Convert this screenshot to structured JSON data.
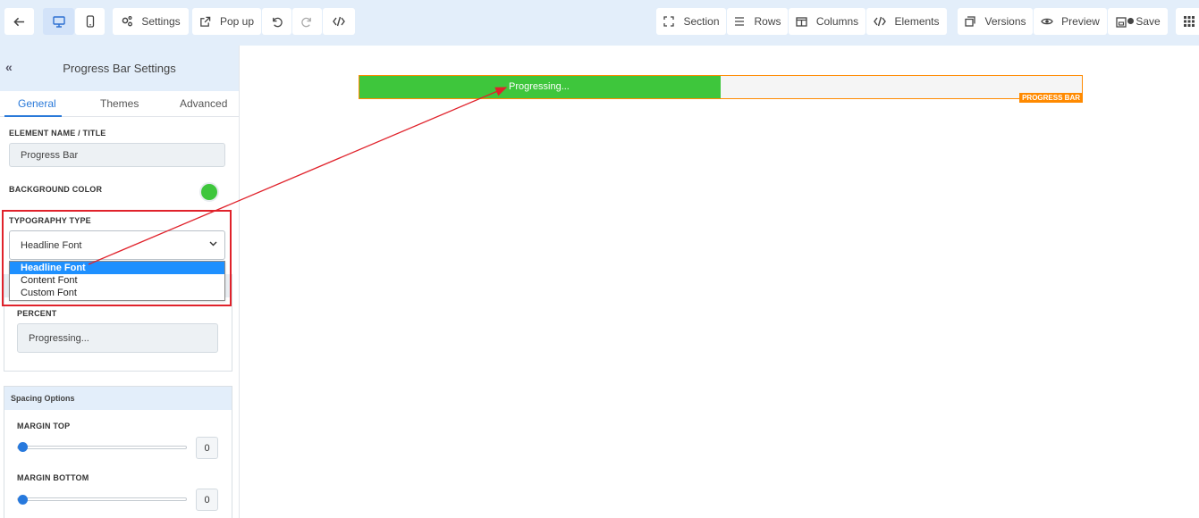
{
  "toolbar": {
    "back_icon": "arrow-left-icon",
    "desktop_icon": "desktop-icon",
    "mobile_icon": "mobile-icon",
    "settings_label": "Settings",
    "popup_label": "Pop up",
    "section_label": "Section",
    "rows_label": "Rows",
    "columns_label": "Columns",
    "elements_label": "Elements",
    "versions_label": "Versions",
    "preview_label": "Preview",
    "save_label": "Save"
  },
  "sidebar": {
    "title": "Progress Bar Settings",
    "collapse_glyph": "«",
    "tabs": [
      {
        "label": "General"
      },
      {
        "label": "Themes"
      },
      {
        "label": "Advanced"
      }
    ],
    "element_name_label": "ELEMENT NAME / TITLE",
    "element_name_value": "Progress Bar",
    "background_color_label": "BACKGROUND COLOR",
    "background_color": "#3ec63c",
    "typography_label": "TYPOGRAPHY TYPE",
    "typography_selected": "Headline Font",
    "typography_options": [
      "Headline Font",
      "Content Font",
      "Custom Font"
    ],
    "percent_label": "PERCENT",
    "percent_value": "Progressing...",
    "spacing_title": "Spacing Options",
    "margin_top_label": "MARGIN TOP",
    "margin_top_value": "0",
    "margin_bottom_label": "MARGIN BOTTOM",
    "margin_bottom_value": "0"
  },
  "canvas": {
    "progress_text": "Progressing...",
    "progress_fraction": 0.5,
    "badge": "PROGRESS BAR",
    "fill_color": "#3ec63c",
    "border_color": "#ff8a00"
  },
  "annotation": {
    "highlight_color": "#e0222b"
  }
}
